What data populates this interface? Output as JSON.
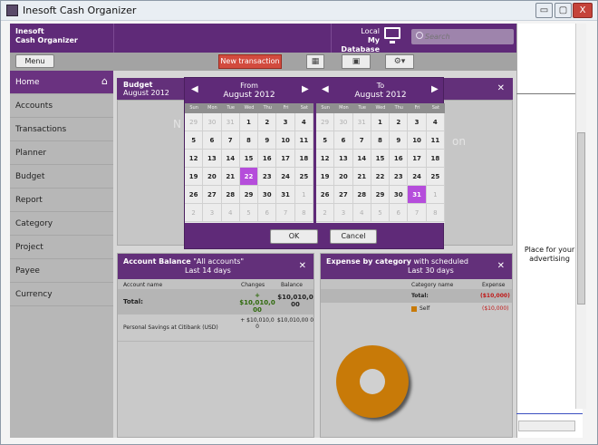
{
  "window": {
    "title": "Inesoft Cash Organizer",
    "btn_min": "▭",
    "btn_max": "▢",
    "btn_close": "X"
  },
  "header": {
    "brand_line1": "Inesoft",
    "brand_line2": "Cash Organizer",
    "db_label": "Local",
    "db_name": "My Database",
    "search_placeholder": "Search"
  },
  "toolbar": {
    "menu": "Menu",
    "new_transaction": "New transaction",
    "calc_icon": "calculator-icon",
    "calendar_icon": "calendar-icon",
    "settings_icon": "gear-icon"
  },
  "sidebar": {
    "items": [
      "Home",
      "Accounts",
      "Transactions",
      "Planner",
      "Budget",
      "Report",
      "Category",
      "Project",
      "Payee",
      "Currency"
    ]
  },
  "budget": {
    "title": "Budget",
    "period": "August 2012",
    "ghost_left": "N",
    "ghost_right": "on"
  },
  "calendar": {
    "from": {
      "label": "From",
      "month": "August 2012"
    },
    "to": {
      "label": "To",
      "month": "August 2012"
    },
    "dow": [
      "Sun",
      "Mon",
      "Tue",
      "Wed",
      "Thu",
      "Fri",
      "Sat"
    ],
    "days": [
      "29",
      "30",
      "31",
      "1",
      "2",
      "3",
      "4",
      "5",
      "6",
      "7",
      "8",
      "9",
      "10",
      "11",
      "12",
      "13",
      "14",
      "15",
      "16",
      "17",
      "18",
      "19",
      "20",
      "21",
      "22",
      "23",
      "24",
      "25",
      "26",
      "27",
      "28",
      "29",
      "30",
      "31",
      "1",
      "2",
      "3",
      "4",
      "5",
      "6",
      "7",
      "8"
    ],
    "from_selected": "22",
    "to_selected": "31",
    "ok": "OK",
    "cancel": "Cancel"
  },
  "account_balance": {
    "title": "Account Balance",
    "filter": "\"All accounts\"",
    "period": "Last 14 days",
    "col_name": "Account name",
    "col_changes": "Changes",
    "col_balance": "Balance",
    "total_label": "Total:",
    "total_changes": "+ $10,010,0 00",
    "total_balance": "$10,010,0 00",
    "row1_name": "Personal Savings at Citibank (USD)",
    "row1_changes": "+ $10,010,0 0",
    "row1_balance": "$10,010,00 0"
  },
  "expense": {
    "title": "Expense by category",
    "filter": "with scheduled",
    "period": "Last 30 days",
    "col_category": "Category name",
    "col_expense": "Expense",
    "total_label": "Total:",
    "total_value": "($10,000)",
    "row1_name": "Self",
    "row1_value": "($10,000)",
    "row1_color": "#c87a08"
  },
  "chart_data": {
    "type": "pie",
    "categories": [
      "Self"
    ],
    "values": [
      10000
    ]
  },
  "ad": {
    "text": "Place for your advertising"
  }
}
